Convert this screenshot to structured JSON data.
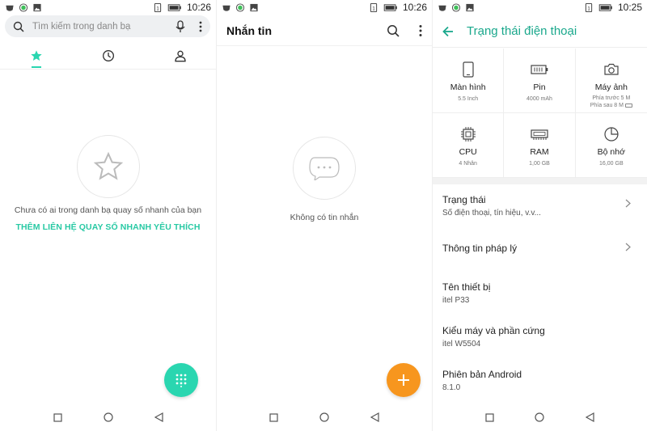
{
  "colors": {
    "accent_teal": "#2ad6b0",
    "accent_orange": "#f7961e",
    "title_teal": "#1aa88c"
  },
  "screen1": {
    "time": "10:26",
    "search_placeholder": "Tìm kiếm trong danh bạ",
    "tabs": [
      {
        "icon": "star-icon",
        "active": true
      },
      {
        "icon": "clock-icon",
        "active": false
      },
      {
        "icon": "person-icon",
        "active": false
      }
    ],
    "empty_message": "Chưa có ai trong danh bạ quay số nhanh của bạn",
    "add_link": "THÊM LIÊN HỆ QUAY SỐ NHANH YÊU THÍCH"
  },
  "screen2": {
    "time": "10:26",
    "title": "Nhắn tin",
    "empty_message": "Không có tin nhắn"
  },
  "screen3": {
    "time": "10:25",
    "title": "Trạng thái điện thoại",
    "cells": [
      {
        "icon": "phone-icon",
        "label": "Màn hình",
        "sub": "5.5 Inch"
      },
      {
        "icon": "battery-icon",
        "label": "Pin",
        "sub": "4000 mAh"
      },
      {
        "icon": "camera-icon",
        "label": "Máy ảnh",
        "sub": "Phía trước 5 M",
        "sub2": "Phía sau 8 M"
      },
      {
        "icon": "cpu-icon",
        "label": "CPU",
        "sub": "4 Nhân"
      },
      {
        "icon": "ram-icon",
        "label": "RAM",
        "sub": "1,00 GB"
      },
      {
        "icon": "storage-icon",
        "label": "Bộ nhớ",
        "sub": "16,00 GB"
      }
    ],
    "items": [
      {
        "title": "Trạng thái",
        "subtitle": "Số điện thoại, tín hiệu, v.v...",
        "chevron": true
      },
      {
        "title": "Thông tin pháp lý",
        "subtitle": "",
        "chevron": true
      },
      {
        "title": "Tên thiết bị",
        "subtitle": "itel P33",
        "chevron": false
      },
      {
        "title": "Kiểu máy và phần cứng",
        "subtitle": "itel W5504",
        "chevron": false
      },
      {
        "title": "Phiên bản Android",
        "subtitle": "8.1.0",
        "chevron": false
      }
    ]
  }
}
